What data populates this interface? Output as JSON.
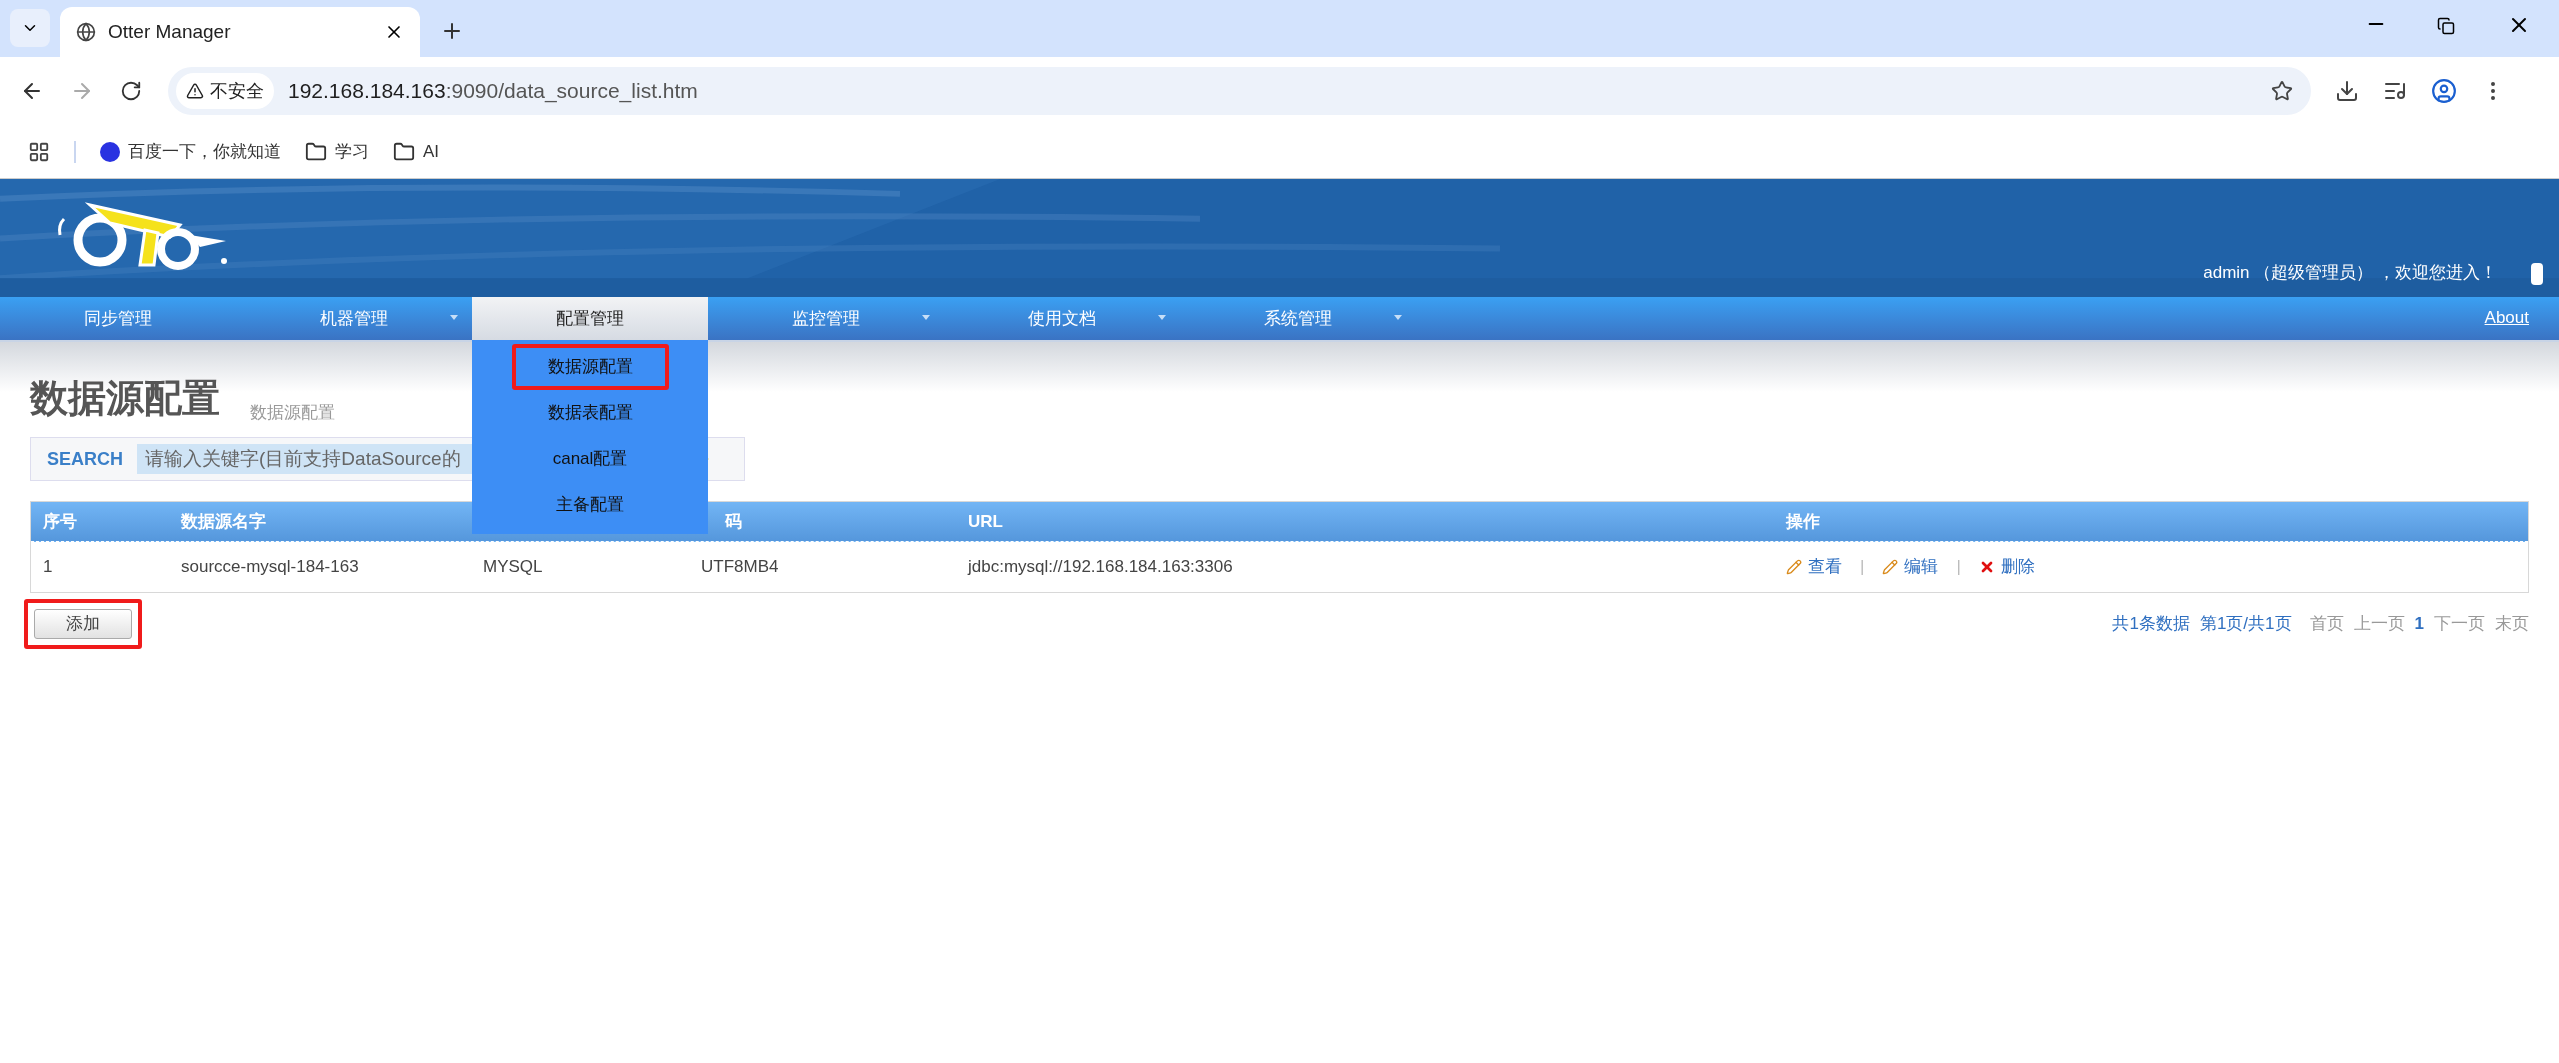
{
  "browser": {
    "tab_title": "Otter Manager",
    "security_label": "不安全",
    "address_host": "192.168.184.163",
    "address_path": ":9090/data_source_list.htm",
    "bookmarks": [
      {
        "kind": "baidu",
        "label": "百度一下，你就知道"
      },
      {
        "kind": "folder",
        "label": "学习"
      },
      {
        "kind": "folder",
        "label": "AI"
      }
    ]
  },
  "header": {
    "user_text": "admin （超级管理员） ，欢迎您进入！"
  },
  "nav": {
    "items": [
      {
        "label": "同步管理",
        "selected": false,
        "has_dropdown": false
      },
      {
        "label": "机器管理",
        "selected": false,
        "has_dropdown": true
      },
      {
        "label": "配置管理",
        "selected": true,
        "has_dropdown": false
      },
      {
        "label": "监控管理",
        "selected": false,
        "has_dropdown": true
      },
      {
        "label": "使用文档",
        "selected": false,
        "has_dropdown": true
      },
      {
        "label": "系统管理",
        "selected": false,
        "has_dropdown": true
      }
    ],
    "about": "About",
    "dropdown": [
      {
        "label": "数据源配置",
        "annotated": true
      },
      {
        "label": "数据表配置",
        "annotated": false
      },
      {
        "label": "canal配置",
        "annotated": false
      },
      {
        "label": "主备配置",
        "annotated": false
      }
    ]
  },
  "page": {
    "title": "数据源配置",
    "subtitle": "数据源配置"
  },
  "search": {
    "label": "SEARCH",
    "placeholder": "请输入关键字(目前支持DataSource的"
  },
  "table": {
    "columns": [
      {
        "label": "序号"
      },
      {
        "label": "数据源名字"
      },
      {
        "covered": true
      },
      {
        "label": "码"
      },
      {
        "label": "URL"
      },
      {
        "label": "操作"
      }
    ],
    "separator": "|",
    "rows": [
      {
        "cells": [
          "1",
          "sourcce-mysql-184-163",
          "MYSQL",
          "UTF8MB4",
          "jdbc:mysql://192.168.184.163:3306"
        ],
        "actions": [
          {
            "kind": "view",
            "label": "查看"
          },
          {
            "kind": "edit",
            "label": "编辑"
          },
          {
            "kind": "delete",
            "label": "删除"
          }
        ]
      }
    ]
  },
  "add_button": {
    "label": "添加",
    "annotated": true
  },
  "pagination": {
    "summary": "共1条数据",
    "page_info": "第1页/共1页",
    "links": [
      {
        "label": "首页",
        "selected": false
      },
      {
        "label": "上一页",
        "selected": false
      },
      {
        "label": "1",
        "selected": true
      },
      {
        "label": "下一页",
        "selected": false
      },
      {
        "label": "末页",
        "selected": false
      }
    ]
  }
}
